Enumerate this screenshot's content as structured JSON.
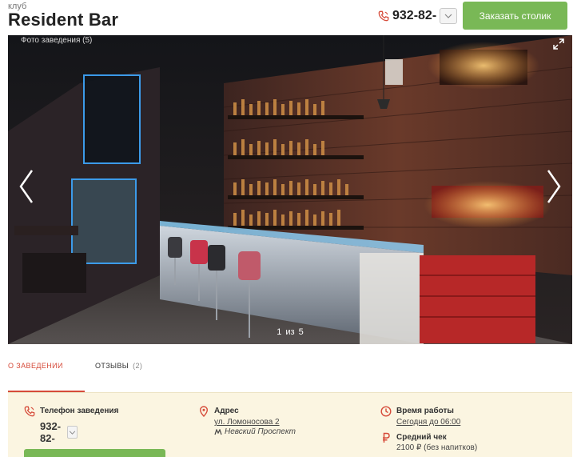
{
  "header": {
    "venue_type": "клуб",
    "venue_name": "Resident Bar",
    "phone": "932-82-",
    "book_button": "Заказать столик",
    "accent_color": "#79b856"
  },
  "gallery": {
    "photos_label": "Фото заведения (5)",
    "current": "1",
    "separator": "из",
    "total": "5"
  },
  "tabs": [
    {
      "label": "О ЗАВЕДЕНИИ",
      "active": true
    },
    {
      "label": "ОТЗЫВЫ",
      "count": "(2)",
      "active": false
    }
  ],
  "info": {
    "phone_title": "Телефон заведения",
    "phone_value": "932-82-",
    "address_title": "Адрес",
    "address_value": "ул. Ломоносова 2",
    "metro": "Невский Проспект",
    "hours_title": "Время работы",
    "hours_value": "Сегодня до 06:00",
    "check_title": "Средний чек",
    "check_value": "2100 ₽ (без напитков)"
  },
  "icons": {
    "phone": "phone-icon",
    "location": "pin-icon",
    "clock": "clock-icon",
    "ruble": "ruble-icon",
    "metro": "metro-icon",
    "expand": "expand-icon",
    "prev": "chevron-left-icon",
    "next": "chevron-right-icon"
  },
  "colors": {
    "accent_red": "#d64b3a",
    "info_bg": "#fbf5e1"
  }
}
